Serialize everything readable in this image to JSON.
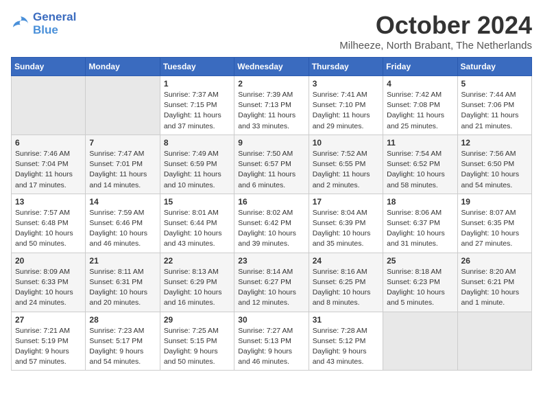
{
  "logo": {
    "line1": "General",
    "line2": "Blue"
  },
  "title": "October 2024",
  "subtitle": "Milheeze, North Brabant, The Netherlands",
  "weekdays": [
    "Sunday",
    "Monday",
    "Tuesday",
    "Wednesday",
    "Thursday",
    "Friday",
    "Saturday"
  ],
  "weeks": [
    [
      {
        "day": "",
        "info": ""
      },
      {
        "day": "",
        "info": ""
      },
      {
        "day": "1",
        "info": "Sunrise: 7:37 AM\nSunset: 7:15 PM\nDaylight: 11 hours\nand 37 minutes."
      },
      {
        "day": "2",
        "info": "Sunrise: 7:39 AM\nSunset: 7:13 PM\nDaylight: 11 hours\nand 33 minutes."
      },
      {
        "day": "3",
        "info": "Sunrise: 7:41 AM\nSunset: 7:10 PM\nDaylight: 11 hours\nand 29 minutes."
      },
      {
        "day": "4",
        "info": "Sunrise: 7:42 AM\nSunset: 7:08 PM\nDaylight: 11 hours\nand 25 minutes."
      },
      {
        "day": "5",
        "info": "Sunrise: 7:44 AM\nSunset: 7:06 PM\nDaylight: 11 hours\nand 21 minutes."
      }
    ],
    [
      {
        "day": "6",
        "info": "Sunrise: 7:46 AM\nSunset: 7:04 PM\nDaylight: 11 hours\nand 17 minutes."
      },
      {
        "day": "7",
        "info": "Sunrise: 7:47 AM\nSunset: 7:01 PM\nDaylight: 11 hours\nand 14 minutes."
      },
      {
        "day": "8",
        "info": "Sunrise: 7:49 AM\nSunset: 6:59 PM\nDaylight: 11 hours\nand 10 minutes."
      },
      {
        "day": "9",
        "info": "Sunrise: 7:50 AM\nSunset: 6:57 PM\nDaylight: 11 hours\nand 6 minutes."
      },
      {
        "day": "10",
        "info": "Sunrise: 7:52 AM\nSunset: 6:55 PM\nDaylight: 11 hours\nand 2 minutes."
      },
      {
        "day": "11",
        "info": "Sunrise: 7:54 AM\nSunset: 6:52 PM\nDaylight: 10 hours\nand 58 minutes."
      },
      {
        "day": "12",
        "info": "Sunrise: 7:56 AM\nSunset: 6:50 PM\nDaylight: 10 hours\nand 54 minutes."
      }
    ],
    [
      {
        "day": "13",
        "info": "Sunrise: 7:57 AM\nSunset: 6:48 PM\nDaylight: 10 hours\nand 50 minutes."
      },
      {
        "day": "14",
        "info": "Sunrise: 7:59 AM\nSunset: 6:46 PM\nDaylight: 10 hours\nand 46 minutes."
      },
      {
        "day": "15",
        "info": "Sunrise: 8:01 AM\nSunset: 6:44 PM\nDaylight: 10 hours\nand 43 minutes."
      },
      {
        "day": "16",
        "info": "Sunrise: 8:02 AM\nSunset: 6:42 PM\nDaylight: 10 hours\nand 39 minutes."
      },
      {
        "day": "17",
        "info": "Sunrise: 8:04 AM\nSunset: 6:39 PM\nDaylight: 10 hours\nand 35 minutes."
      },
      {
        "day": "18",
        "info": "Sunrise: 8:06 AM\nSunset: 6:37 PM\nDaylight: 10 hours\nand 31 minutes."
      },
      {
        "day": "19",
        "info": "Sunrise: 8:07 AM\nSunset: 6:35 PM\nDaylight: 10 hours\nand 27 minutes."
      }
    ],
    [
      {
        "day": "20",
        "info": "Sunrise: 8:09 AM\nSunset: 6:33 PM\nDaylight: 10 hours\nand 24 minutes."
      },
      {
        "day": "21",
        "info": "Sunrise: 8:11 AM\nSunset: 6:31 PM\nDaylight: 10 hours\nand 20 minutes."
      },
      {
        "day": "22",
        "info": "Sunrise: 8:13 AM\nSunset: 6:29 PM\nDaylight: 10 hours\nand 16 minutes."
      },
      {
        "day": "23",
        "info": "Sunrise: 8:14 AM\nSunset: 6:27 PM\nDaylight: 10 hours\nand 12 minutes."
      },
      {
        "day": "24",
        "info": "Sunrise: 8:16 AM\nSunset: 6:25 PM\nDaylight: 10 hours\nand 8 minutes."
      },
      {
        "day": "25",
        "info": "Sunrise: 8:18 AM\nSunset: 6:23 PM\nDaylight: 10 hours\nand 5 minutes."
      },
      {
        "day": "26",
        "info": "Sunrise: 8:20 AM\nSunset: 6:21 PM\nDaylight: 10 hours\nand 1 minute."
      }
    ],
    [
      {
        "day": "27",
        "info": "Sunrise: 7:21 AM\nSunset: 5:19 PM\nDaylight: 9 hours\nand 57 minutes."
      },
      {
        "day": "28",
        "info": "Sunrise: 7:23 AM\nSunset: 5:17 PM\nDaylight: 9 hours\nand 54 minutes."
      },
      {
        "day": "29",
        "info": "Sunrise: 7:25 AM\nSunset: 5:15 PM\nDaylight: 9 hours\nand 50 minutes."
      },
      {
        "day": "30",
        "info": "Sunrise: 7:27 AM\nSunset: 5:13 PM\nDaylight: 9 hours\nand 46 minutes."
      },
      {
        "day": "31",
        "info": "Sunrise: 7:28 AM\nSunset: 5:12 PM\nDaylight: 9 hours\nand 43 minutes."
      },
      {
        "day": "",
        "info": ""
      },
      {
        "day": "",
        "info": ""
      }
    ]
  ]
}
